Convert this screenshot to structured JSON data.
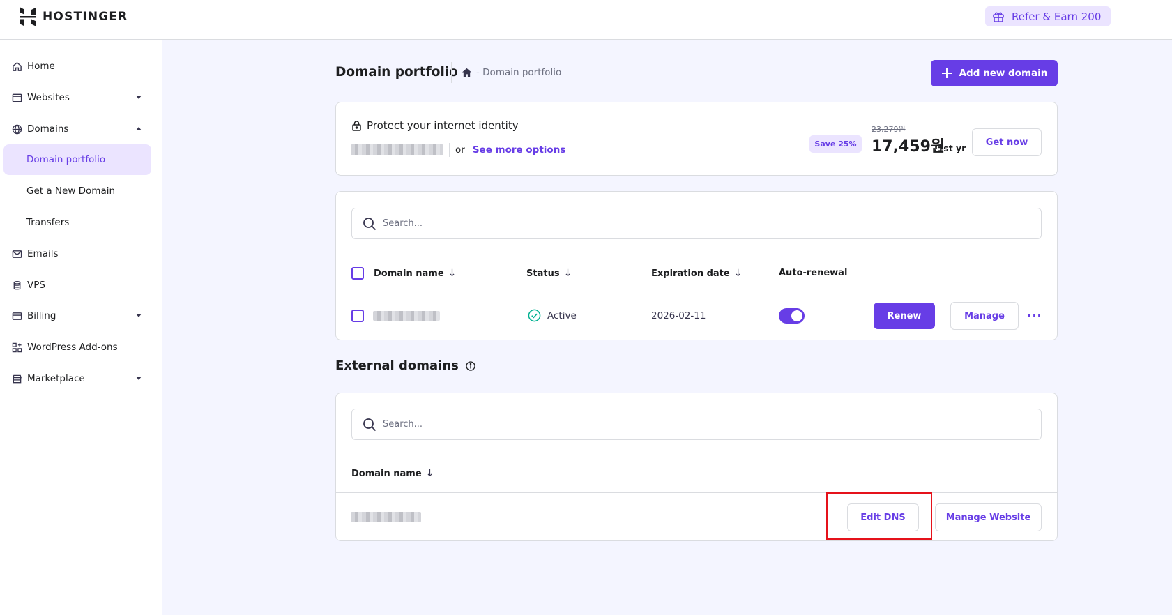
{
  "brand": {
    "name": "HOSTINGER"
  },
  "header": {
    "refer_label": "Refer & Earn 200"
  },
  "sidebar": {
    "items": [
      {
        "label": "Home",
        "icon": "home-icon"
      },
      {
        "label": "Websites",
        "icon": "browser-window-icon"
      },
      {
        "label": "Domains",
        "icon": "globe-icon"
      },
      {
        "label": "Domain portfolio",
        "active": true
      },
      {
        "label": "Get a New Domain"
      },
      {
        "label": "Transfers"
      },
      {
        "label": "Emails",
        "icon": "mail-icon"
      },
      {
        "label": "VPS",
        "icon": "server-icon"
      },
      {
        "label": "Billing",
        "icon": "card-icon"
      },
      {
        "label": "WordPress Add-ons",
        "icon": "grid-plus-icon"
      },
      {
        "label": "Marketplace",
        "icon": "store-icon"
      }
    ]
  },
  "page": {
    "title": "Domain portfolio",
    "breadcrumb": "- Domain portfolio",
    "add_button": "Add new domain"
  },
  "promo": {
    "heading": "Protect your internet identity",
    "or_text": "or",
    "more_link": "See more options",
    "save_badge": "Save 25%",
    "old_price": "23,279원",
    "new_price": "17,459원",
    "period": "/1st yr",
    "cta": "Get now"
  },
  "domains_table": {
    "search_placeholder": "Search...",
    "columns": [
      "Domain name",
      "Status",
      "Expiration date",
      "Auto-renewal"
    ],
    "rows": [
      {
        "status": "Active",
        "expiration": "2026-02-11",
        "auto_renewal": true,
        "renew_label": "Renew",
        "manage_label": "Manage",
        "more_label": "···"
      }
    ]
  },
  "external": {
    "title": "External domains",
    "search_placeholder": "Search...",
    "column": "Domain name",
    "edit_dns_label": "Edit DNS",
    "manage_website_label": "Manage Website"
  },
  "colors": {
    "accent": "#673de6",
    "accent_light": "#ebe4ff",
    "success": "#00b090",
    "highlight": "#e5121b"
  }
}
